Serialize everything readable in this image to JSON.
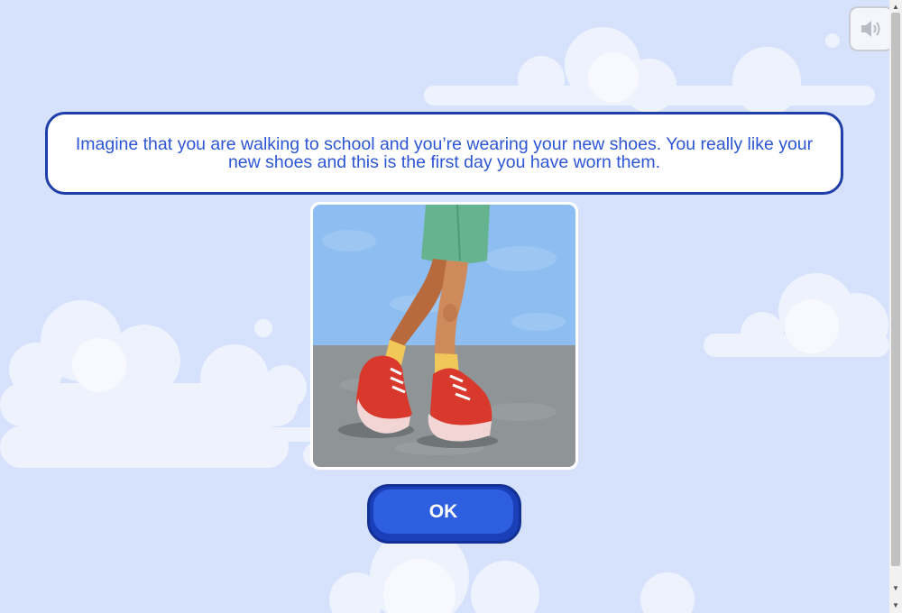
{
  "prompt": {
    "text": "Imagine that you are walking to school and you’re wearing your new shoes. You really like your new shoes and this is the first day you have worn them."
  },
  "sound_button": {
    "icon": "speaker-icon"
  },
  "scene": {
    "icon": "red-sneakers-walking-illustration"
  },
  "ok_button": {
    "label": "OK"
  },
  "colors": {
    "background": "#d6e1fc",
    "prompt_border": "#1f3fa8",
    "prompt_text": "#2d56d6",
    "button_fill": "#2e5fe0",
    "button_border": "#123095"
  }
}
